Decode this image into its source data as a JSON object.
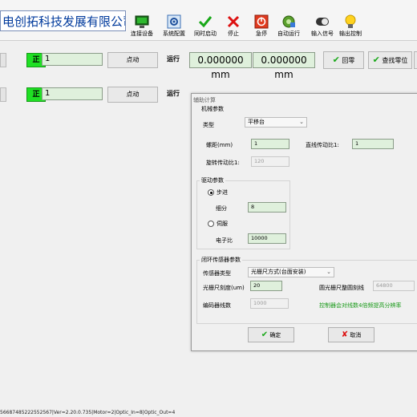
{
  "company": "电创拓科技发展有限公司",
  "toolbar": [
    {
      "label": "连接设备",
      "icon": "connect-device-icon"
    },
    {
      "label": "系统配置",
      "icon": "system-config-icon"
    },
    {
      "label": "同时启动",
      "icon": "start-check-icon"
    },
    {
      "label": "停止",
      "icon": "stop-x-icon"
    },
    {
      "label": "急停",
      "icon": "emergency-stop-icon"
    },
    {
      "label": "自动运行",
      "icon": "auto-run-icon"
    },
    {
      "label": "输入信号",
      "icon": "input-signal-icon"
    },
    {
      "label": "输出控制",
      "icon": "output-control-icon"
    }
  ],
  "axes": [
    {
      "direction": "正",
      "step": "1",
      "jog": "点动",
      "run": "运行",
      "pos1": "0.000000 mm",
      "pos2": "0.000000 mm",
      "home": "回零",
      "find_zero": "查找零位"
    },
    {
      "direction": "正",
      "step": "1",
      "jog": "点动",
      "run": "运行"
    }
  ],
  "dialog": {
    "title": "辅助计算",
    "mech": {
      "title": "机械参数",
      "type_label": "类型",
      "type_value": "平移台",
      "pitch_label": "螺距(mm)",
      "pitch_value": "1",
      "linear_ratio_label": "直线传动比1:",
      "linear_ratio_value": "1",
      "rot_ratio_label": "旋转传动比1:",
      "rot_ratio_value": "120"
    },
    "drive": {
      "title": "驱动参数",
      "stepper_label": "步进",
      "subdiv_label": "细分",
      "subdiv_value": "8",
      "servo_label": "伺服",
      "egear_label": "电子比",
      "egear_value": "10000"
    },
    "closed": {
      "title": "闭环传感器参数",
      "sensor_type_label": "传感器类型",
      "sensor_type_value": "光栅尺方式(台面安装)",
      "grating_label": "光栅尺刻度(um)",
      "grating_value": "20",
      "circ_label": "圆光栅尺整圆刻线",
      "circ_value": "64800",
      "encoder_label": "编码器线数",
      "encoder_value": "1000",
      "note": "控制器会对线数4倍频提高分辨率"
    },
    "ok": "确定",
    "cancel": "取消"
  },
  "status": "56687485222552567|Ver=2.20.0.735|Motor=2|Optic_In=8|Optic_Out=4"
}
